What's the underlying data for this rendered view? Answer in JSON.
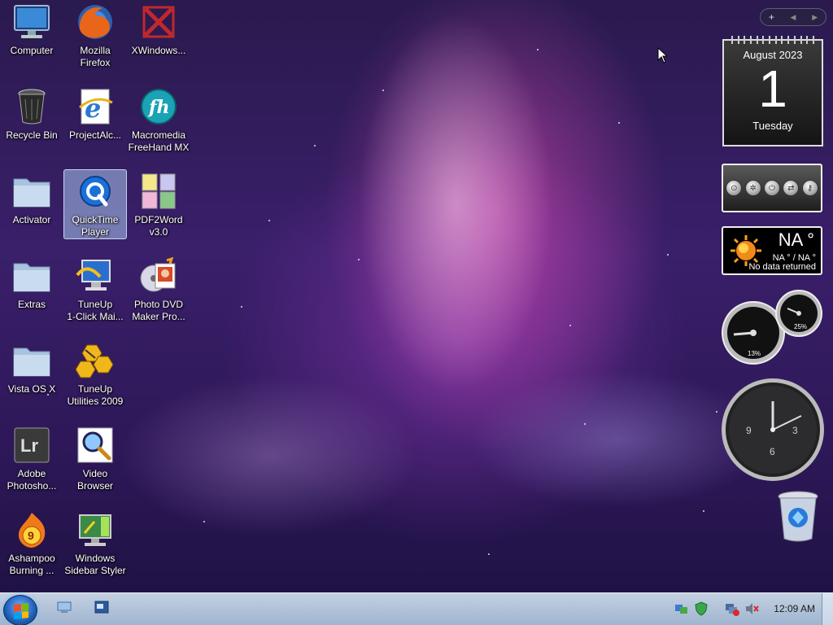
{
  "desktop": {
    "icons": [
      {
        "label": "Computer"
      },
      {
        "label": "Mozilla\nFirefox"
      },
      {
        "label": "XWindows..."
      },
      {
        "label": "Recycle Bin"
      },
      {
        "label": "ProjectAlc..."
      },
      {
        "label": "Macromedia\nFreeHand MX"
      },
      {
        "label": "Activator"
      },
      {
        "label": "QuickTime\nPlayer"
      },
      {
        "label": "PDF2Word\nv3.0"
      },
      {
        "label": "Extras"
      },
      {
        "label": "TuneUp\n1-Click Mai..."
      },
      {
        "label": "Photo DVD\nMaker Pro..."
      },
      {
        "label": "Vista OS X"
      },
      {
        "label": "TuneUp\nUtilities 2009"
      },
      {
        "label": "Adobe\nPhotosho..."
      },
      {
        "label": "Video\nBrowser"
      },
      {
        "label": "Ashampoo\nBurning ..."
      },
      {
        "label": "Windows\nSidebar Styler"
      }
    ],
    "selected_icon": "QuickTime\nPlayer"
  },
  "sidebar": {
    "controls": {
      "add": "+",
      "prev": "◀",
      "next": "▶"
    },
    "calendar": {
      "month_year": "August 2023",
      "day": "1",
      "weekday": "Tuesday"
    },
    "weather": {
      "temperature": "NA °",
      "range": "NA ° / NA °",
      "status": "No data returned"
    },
    "meters": {
      "cpu": "13%",
      "memory": "25%"
    },
    "clock": {
      "numerals": [
        "3",
        "6",
        "9"
      ]
    }
  },
  "taskbar": {
    "time": "12:09 AM"
  },
  "colors": {
    "wallpaper_primary": "#3a1f6a",
    "wallpaper_accent": "#e04fb8",
    "taskbar": "#c5d6e8",
    "selection": "#aac8f0"
  }
}
